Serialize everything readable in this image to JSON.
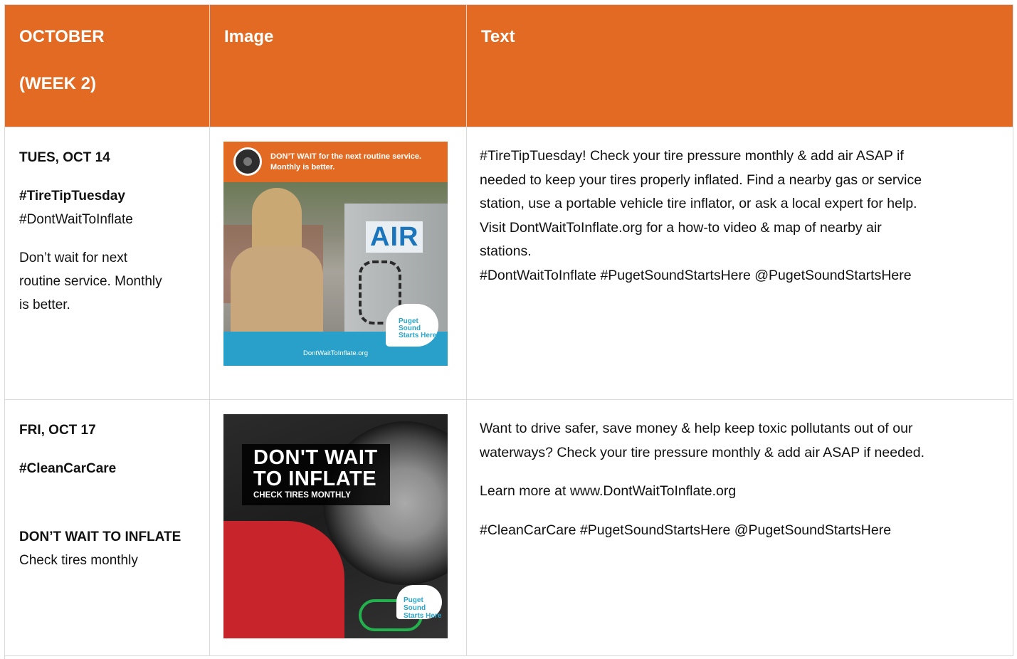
{
  "header": {
    "col1_line1": "OCTOBER",
    "col1_line2": "(WEEK 2)",
    "col2": "Image",
    "col3": "Text"
  },
  "rows": [
    {
      "date": "TUES, OCT 14",
      "tag_bold": "#TireTipTuesday",
      "tag": "#DontWaitToInflate",
      "note_lines": [
        "Don’t wait for next",
        "routine service. Monthly",
        "is better."
      ],
      "image": {
        "headline": "DON’T WAIT for the next routine service. Monthly is better.",
        "sign": "AIR",
        "logo": "Puget Sound Starts Here",
        "url": "DontWaitToInflate.org"
      },
      "text_lines": [
        "#TireTipTuesday! Check your tire pressure monthly & add air ASAP if",
        "needed to keep your tires properly inflated. Find a nearby gas or service",
        "station, use a portable vehicle tire inflator, or ask a local expert for help.",
        "Visit DontWaitToInflate.org for a how-to video & map of nearby air",
        "stations.",
        "#DontWaitToInflate #PugetSoundStartsHere @PugetSoundStartsHere"
      ]
    },
    {
      "date": "FRI, OCT 17",
      "tag_bold": "#CleanCarCare",
      "headline": "DON’T WAIT TO INFLATE",
      "subline": "Check tires monthly",
      "image": {
        "line1": "DON'T WAIT",
        "line2": "TO INFLATE",
        "line3": "CHECK TIRES MONTHLY",
        "logo": "Puget Sound Starts Here"
      },
      "text_p1_lines": [
        "Want to drive safer, save money & help keep toxic pollutants out of our",
        "waterways? Check your tire pressure monthly & add air ASAP if needed."
      ],
      "text_p2": "Learn more at www.DontWaitToInflate.org",
      "text_p3": "#CleanCarCare #PugetSoundStartsHere @PugetSoundStartsHere"
    }
  ],
  "colors": {
    "header_bg": "#e26a22",
    "border": "#d9d9d9"
  }
}
